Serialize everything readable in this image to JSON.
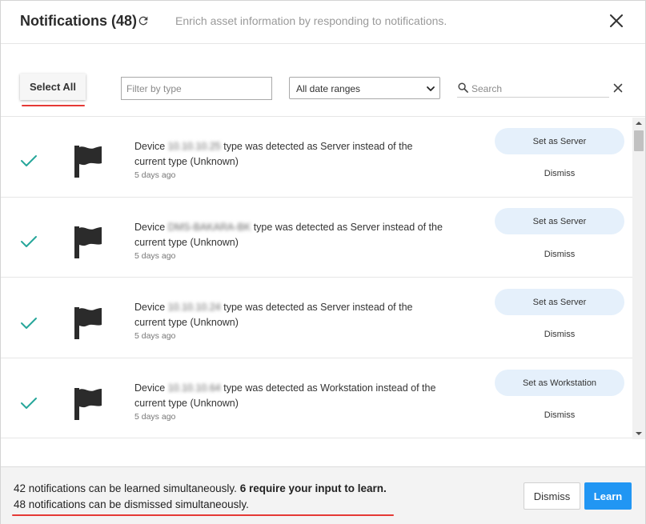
{
  "header": {
    "title": "Notifications (48)",
    "subtitle": "Enrich asset information by responding to notifications.",
    "icons": {
      "refresh": "refresh-icon",
      "close": "close-icon"
    }
  },
  "toolbar": {
    "select_all_label": "Select All",
    "filter_type_placeholder": "Filter by type",
    "date_range_selected": "All date ranges",
    "search_placeholder": "Search",
    "icons": {
      "search": "search-icon",
      "clear": "clear-search-icon",
      "chevron": "chevron-down-icon"
    }
  },
  "notifications": [
    {
      "prefix": "Device",
      "device": "10.10.10.25",
      "middle": "type was detected as Server instead of the",
      "line2": "current type (Unknown)",
      "time": "5 days ago",
      "action_label": "Set as Server",
      "dismiss_label": "Dismiss"
    },
    {
      "prefix": "Device",
      "device": "DMS-BAKARA-BK",
      "middle": "type was detected as Server instead of the",
      "line2": "current type (Unknown)",
      "time": "5 days ago",
      "action_label": "Set as Server",
      "dismiss_label": "Dismiss"
    },
    {
      "prefix": "Device",
      "device": "10.10.10.24",
      "middle": "type was detected as Server instead of the",
      "line2": "current type (Unknown)",
      "time": "5 days ago",
      "action_label": "Set as Server",
      "dismiss_label": "Dismiss"
    },
    {
      "prefix": "Device",
      "device": "10.10.10.64",
      "middle": "type was detected as Workstation instead of the",
      "line2": "current type (Unknown)",
      "time": "5 days ago",
      "action_label": "Set as Workstation",
      "dismiss_label": "Dismiss"
    }
  ],
  "footer": {
    "learn_text": "42 notifications can be learned simultaneously.",
    "learn_text_bold": "6 require your input to learn.",
    "dismiss_text": "48 notifications can be dismissed simultaneously.",
    "dismiss_button": "Dismiss",
    "learn_button": "Learn"
  },
  "colors": {
    "accent": "#2196f3",
    "action_button_bg": "#e5f0fb",
    "check": "#26a69a",
    "highlight_underline": "#e53935",
    "footer_bg": "#f3f3f3"
  }
}
